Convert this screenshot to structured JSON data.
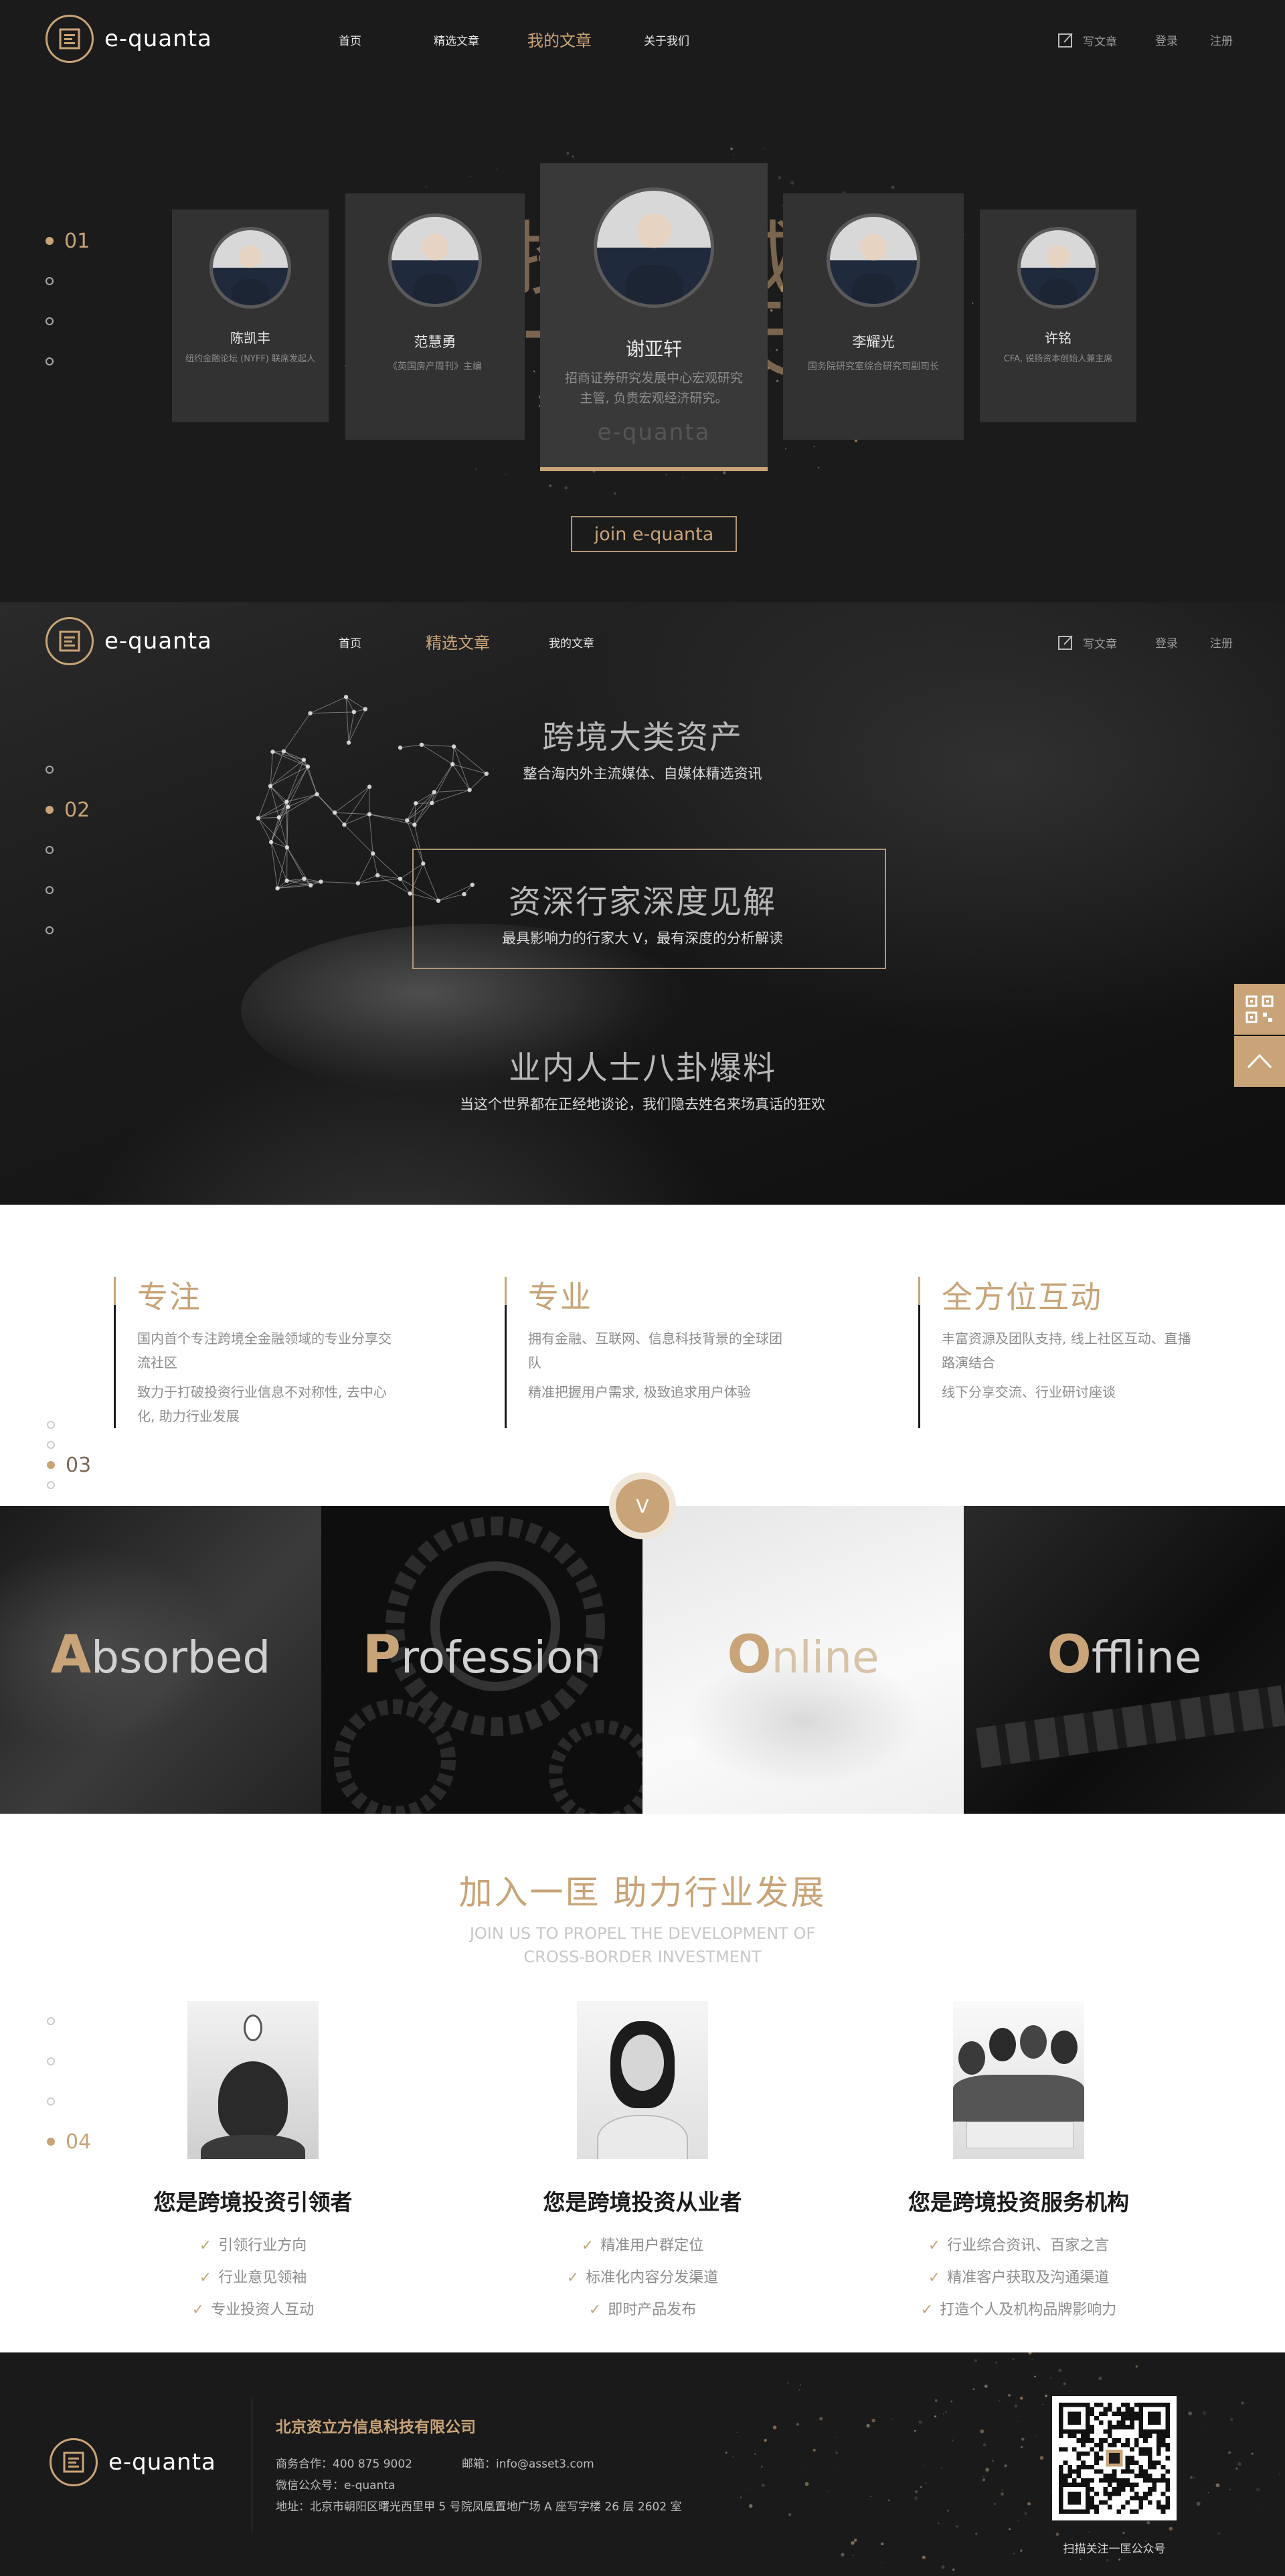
{
  "brand": {
    "name": "e-quanta",
    "accent": "#c8a478",
    "dark": "#1c1b1c"
  },
  "nav1": {
    "home": "首页",
    "featured": "精选文章",
    "my": "我的文章",
    "about": "关于我们",
    "write": "写文章",
    "login": "登录",
    "register": "注册"
  },
  "slide1": {
    "num": "01",
    "people": [
      {
        "name": "陈凯丰",
        "desc": "纽约金融论坛 (NYFF) 联席发起人"
      },
      {
        "name": "范慧勇",
        "desc": "《英国房产周刊》主编"
      },
      {
        "name": "谢亚轩",
        "desc": "招商证券研究发展中心宏观研究主管, 负责宏观经济研究。"
      },
      {
        "name": "李耀光",
        "desc": "国务院研究室综合研究司副司长"
      },
      {
        "name": "许铭",
        "desc": "CFA, 锐扬资本创始人兼主席"
      }
    ],
    "watermark": "e-quanta",
    "calligraphy": [
      "投",
      "城",
      "一",
      "匡",
      "天",
      "下"
    ],
    "join_label": "join e-quanta"
  },
  "nav2": {
    "home": "首页",
    "featured": "精选文章",
    "my": "我的文章",
    "write": "写文章",
    "login": "登录",
    "register": "注册"
  },
  "slide2": {
    "num": "02",
    "blocks": [
      {
        "title": "跨境大类资产",
        "sub": "整合海内外主流媒体、自媒体精选资讯"
      },
      {
        "title": "资深行家深度见解",
        "sub": "最具影响力的行家大 V，最有深度的分析解读"
      },
      {
        "title": "业内人士八卦爆料",
        "sub": "当这个世界都在正经地谈论，我们隐去姓名来场真话的狂欢"
      }
    ]
  },
  "features": {
    "num": "03",
    "cols": [
      {
        "title": "专注",
        "lines": [
          "国内首个专注跨境全金融领域的专业分享交流社区",
          "致力于打破投资行业信息不对称性, 去中心化, 助力行业发展"
        ]
      },
      {
        "title": "专业",
        "lines": [
          "拥有金融、互联网、信息科技背景的全球团队",
          "精准把握用户需求, 极致追求用户体验"
        ]
      },
      {
        "title": "全方位互动",
        "lines": [
          "丰富资源及团队支持, 线上社区互动、直播路演结合",
          "线下分享交流、行业研讨座谈"
        ]
      }
    ],
    "badge": "V"
  },
  "apol": [
    {
      "first": "A",
      "rest": "bsorbed"
    },
    {
      "first": "P",
      "rest": "rofession"
    },
    {
      "first": "O",
      "rest": "nline"
    },
    {
      "first": "O",
      "rest": "ffline"
    }
  ],
  "join": {
    "num": "04",
    "title": "加入一匡 助力行业发展",
    "sub1": "JOIN US TO PROPEL THE DEVELOPMENT OF",
    "sub2": "CROSS-BORDER INVESTMENT",
    "roles": [
      {
        "title": "您是跨境投资引领者",
        "items": [
          "引领行业方向",
          "行业意见领袖",
          "专业投资人互动"
        ]
      },
      {
        "title": "您是跨境投资从业者",
        "items": [
          "精准用户群定位",
          "标准化内容分发渠道",
          "即时产品发布"
        ]
      },
      {
        "title": "您是跨境投资服务机构",
        "items": [
          "行业综合资讯、百家之言",
          "精准客户获取及沟通渠道",
          "打造个人及机构品牌影响力"
        ]
      }
    ]
  },
  "footer": {
    "company": "北京资立方信息科技有限公司",
    "business": "商务合作：400 875 9002",
    "email": "邮箱：info@asset3.com",
    "wechat": "微信公众号：e-quanta",
    "address": "地址：北京市朝阳区曙光西里甲 5 号院凤凰置地广场 A 座写字楼 26 层 2602 室",
    "qr_caption": "扫描关注一匡公众号"
  }
}
